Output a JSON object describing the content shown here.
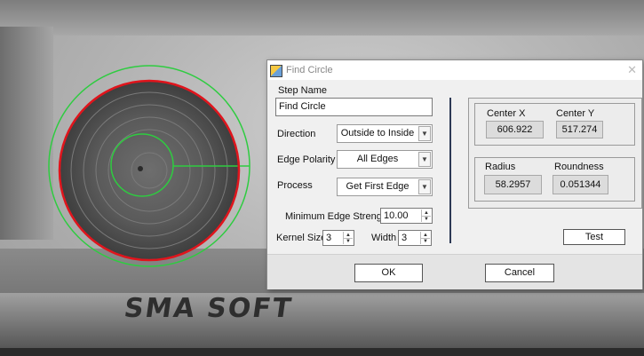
{
  "background": {
    "sticker_text": "ＳＭＡ ＳＯＦＴ",
    "logo_text": "SMA SOFT"
  },
  "overlay_colors": {
    "edge": "#e0141c",
    "search_ring": "#2ecc40"
  },
  "dialog": {
    "title": "Find Circle",
    "close_glyph": "✕",
    "step_name_label": "Step Name",
    "step_name_value": "Find Circle",
    "direction_label": "Direction",
    "direction_value": "Outside to Inside",
    "edge_polarity_label": "Edge Polarity",
    "edge_polarity_value": "All Edges",
    "process_label": "Process",
    "process_value": "Get First Edge",
    "min_edge_strength_label": "Minimum Edge Strength",
    "min_edge_strength_value": "10.00",
    "kernel_size_label": "Kernel Size",
    "kernel_size_value": "3",
    "width_label": "Width",
    "width_value": "3",
    "results": {
      "center_x_label": "Center X",
      "center_x_value": "606.922",
      "center_y_label": "Center Y",
      "center_y_value": "517.274",
      "radius_label": "Radius",
      "radius_value": "58.2957",
      "roundness_label": "Roundness",
      "roundness_value": "0.051344"
    },
    "test_button": "Test",
    "ok_button": "OK",
    "cancel_button": "Cancel"
  }
}
